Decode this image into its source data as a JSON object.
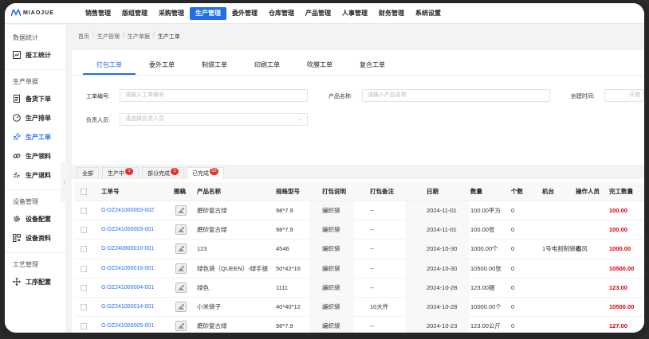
{
  "app": {
    "logo_text": "MIAOJUE"
  },
  "topnav": [
    "销售管理",
    "版组管理",
    "采购管理",
    "生产管理",
    "委外管理",
    "仓库管理",
    "产品管理",
    "人事管理",
    "财务管理",
    "系统设置"
  ],
  "topnav_active": 3,
  "sidebar": {
    "g1": "数据统计",
    "i_report": "报工统计",
    "g2": "生产单据",
    "i_stock": "备货下单",
    "i_schedule": "生产排单",
    "i_workorder": "生产工单",
    "i_picking": "生产领料",
    "i_return": "生产退料",
    "g3": "设备管理",
    "i_devcfg": "设备配置",
    "i_devdata": "设备资料",
    "g4": "工艺管理",
    "i_process": "工序配置"
  },
  "breadcrumb": [
    "首页",
    "生产管理",
    "生产单据",
    "生产工单"
  ],
  "tabs": [
    "打包工单",
    "委外工单",
    "制袋工单",
    "印刷工单",
    "吹膜工单",
    "复合工单"
  ],
  "filters": {
    "order_no_label": "工单编号:",
    "order_no_ph": "请输入工单编号",
    "product_label": "产品名称:",
    "product_ph": "请输入产品名称",
    "created_label": "创建时间:",
    "created_ph": "开始",
    "owner_label": "负责人员:",
    "owner_ph": "请选择负责人员"
  },
  "status_tabs": {
    "all": "全部",
    "in_progress": "生产中",
    "in_progress_count": "1",
    "partial": "部分完成",
    "partial_count": "1",
    "done": "已完成",
    "done_count": "32"
  },
  "table": {
    "headers": {
      "order_no": "工单号",
      "drawing": "图稿",
      "product": "产品名称",
      "spec": "规格型号",
      "pack_desc": "打包说明",
      "pack_note": "打包备注",
      "date": "日期",
      "qty": "数量",
      "pcs": "个数",
      "machine": "机台",
      "operator": "操作人员",
      "done_qty": "完工数量"
    },
    "rows": [
      {
        "order_no": "G-DZ241000003-002",
        "product": "磨砂复古绿",
        "spec": "98*7.9",
        "pack_desc": "编织袋",
        "pack_note": "--",
        "date": "2024-11-01",
        "qty": "100.00平方",
        "pcs": "0",
        "machine": "",
        "operator": "",
        "done_qty": "100.00"
      },
      {
        "order_no": "G-DZ241000003-001",
        "product": "磨砂复古绿",
        "spec": "98*7.9",
        "pack_desc": "编织袋",
        "pack_note": "--",
        "date": "2024-11-01",
        "qty": "100.00张",
        "pcs": "0",
        "machine": "",
        "operator": "",
        "done_qty": "100.00"
      },
      {
        "order_no": "G-DZ240800010-001",
        "product": "123",
        "spec": "4546",
        "pack_desc": "编织袋",
        "pack_note": "--",
        "date": "2024-10-30",
        "qty": "1000.00个",
        "pcs": "0",
        "machine": "1号电割制袋机",
        "operator": "春风",
        "done_qty": "1000.00"
      },
      {
        "order_no": "G-DZ241000016-001",
        "product": "绿色袋（QUEEN）-绿手提",
        "spec": "50*42*16",
        "pack_desc": "编织袋",
        "pack_note": "--",
        "date": "2024-10-30",
        "qty": "10500.00张",
        "pcs": "0",
        "machine": "",
        "operator": "",
        "done_qty": "10500.00"
      },
      {
        "order_no": "G-DZ241000004-001",
        "product": "绿色",
        "spec": "1111",
        "pack_desc": "编织袋",
        "pack_note": "--",
        "date": "2024-10-28",
        "qty": "123.00捆",
        "pcs": "0",
        "machine": "",
        "operator": "",
        "done_qty": "123.00"
      },
      {
        "order_no": "G-DZ241000014-001",
        "product": "小米袋子",
        "spec": "40*40*12",
        "pack_desc": "编织袋",
        "pack_note": "10大件",
        "date": "2024-10-28",
        "qty": "10000.00个",
        "pcs": "0",
        "machine": "",
        "operator": "",
        "done_qty": "10500.00"
      },
      {
        "order_no": "G-DZ241000005-001",
        "product": "磨砂复古绿",
        "spec": "98*7.9",
        "pack_desc": "编织袋",
        "pack_note": "--",
        "date": "2024-10-23",
        "qty": "123.00公斤",
        "pcs": "0",
        "machine": "",
        "operator": "",
        "done_qty": "127.00"
      }
    ]
  },
  "colors": {
    "accent": "#1f6feb",
    "danger": "#d7000f",
    "badge": "#e5322d"
  }
}
